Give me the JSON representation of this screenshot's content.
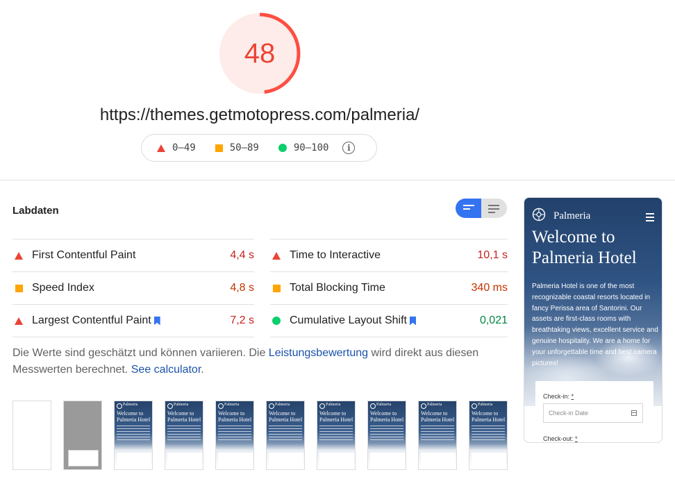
{
  "score": {
    "value": "48",
    "fraction": 0.48,
    "color": "#eb4335",
    "bg_color": "#fdece9"
  },
  "url": "https://themes.getmotopress.com/palmeria/",
  "legend": {
    "fail": "0–49",
    "average": "50–89",
    "pass": "90–100",
    "colors": {
      "fail": "#eb4335",
      "average": "#ffa400",
      "pass": "#0cce6b"
    }
  },
  "lab": {
    "title": "Labdaten",
    "metrics_left": [
      {
        "name": "First Contentful Paint",
        "value": "4,4 s",
        "status": "fail",
        "bookmark": false
      },
      {
        "name": "Speed Index",
        "value": "4,8 s",
        "status": "average",
        "bookmark": false
      },
      {
        "name": "Largest Contentful Paint",
        "value": "7,2 s",
        "status": "fail",
        "bookmark": true
      }
    ],
    "metrics_right": [
      {
        "name": "Time to Interactive",
        "value": "10,1 s",
        "status": "fail",
        "bookmark": false
      },
      {
        "name": "Total Blocking Time",
        "value": "340 ms",
        "status": "average",
        "bookmark": false
      },
      {
        "name": "Cumulative Layout Shift",
        "value": "0,021",
        "status": "pass",
        "bookmark": true
      }
    ],
    "note": {
      "part1": "Die Werte sind geschätzt und können variieren. Die ",
      "link1": "Leistungsbewertung",
      "part2": " wird direkt aus diesen Messwerten berechnet. ",
      "link2": "See calculator",
      "part3": "."
    }
  },
  "filmstrip": {
    "frames": [
      "blank",
      "gray",
      "site",
      "site",
      "site",
      "site",
      "site",
      "site",
      "site",
      "site"
    ],
    "site_brand": "Palmeria",
    "site_headline": "Welcome to Palmeria Hotel"
  },
  "preview": {
    "brand": "Palmeria",
    "headline": "Welcome to Palmeria Hotel",
    "text": "Palmeria Hotel is one of the most recognizable coastal resorts located in fancy Perissa area of Santorini. Our assets are first-class rooms with breathtaking views, excellent service and genuine hospitality. We are a home for your unforgettable time and best camera pictures!",
    "checkin_label": "Check-in:",
    "checkin_placeholder": "Check-in Date",
    "checkout_label": "Check-out:",
    "required_mark": "*"
  }
}
